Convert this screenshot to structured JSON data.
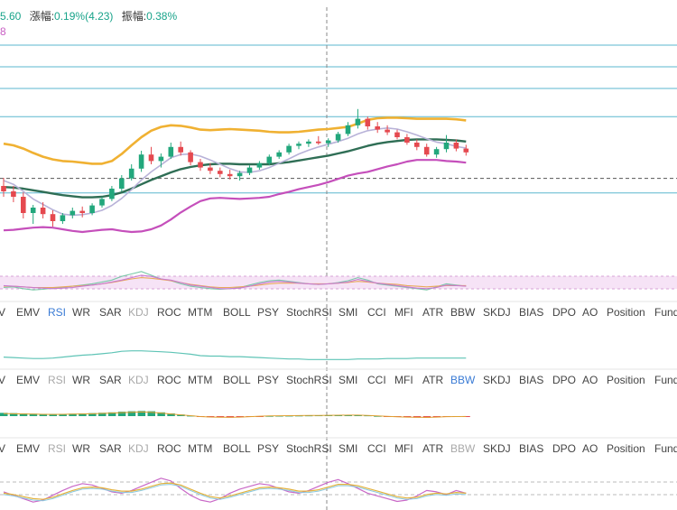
{
  "info": {
    "price_fragment": "5.60",
    "change_label": "漲幅:",
    "change_value": "0.19%(4.23)",
    "amplitude_label": "振幅:",
    "amplitude_value": "0.38%",
    "indicator_fragment": "8"
  },
  "colors": {
    "up": "#22a77c",
    "down": "#e5494f",
    "boll_upper": "#f0b132",
    "boll_mid": "#2f6e55",
    "boll_lower": "#c54fbb",
    "ma": "#b8b2d8",
    "hline": "#5bb7cf",
    "rsi_fill": "#f6e3f6",
    "tab_active": "#3a7bd5"
  },
  "tab_strips": [
    {
      "active": "RSI",
      "dim": [
        "KDJ"
      ]
    },
    {
      "active": "BBW",
      "dim": [
        "RSI",
        "KDJ"
      ]
    },
    {
      "active": "",
      "dim": [
        "RSI",
        "KDJ",
        "BBW"
      ]
    }
  ],
  "tabs": [
    "V",
    "EMV",
    "RSI",
    "WR",
    "SAR",
    "KDJ",
    "ROC",
    "MTM",
    "BOLL",
    "PSY",
    "StochRSI",
    "SMI",
    "CCI",
    "MFI",
    "ATR",
    "BBW",
    "SKDJ",
    "BIAS",
    "DPO",
    "AO",
    "Position",
    "Fund"
  ],
  "chart_data": {
    "type": "candlestick",
    "candles": [
      [
        56,
        57.5,
        54,
        55
      ],
      [
        55,
        56,
        53,
        54
      ],
      [
        54,
        54.8,
        50,
        51
      ],
      [
        51,
        52.5,
        49,
        52
      ],
      [
        52,
        53,
        50,
        50.8
      ],
      [
        50.8,
        51.5,
        48.5,
        49.5
      ],
      [
        49.5,
        51,
        49,
        50.6
      ],
      [
        50.6,
        52,
        50,
        51.4
      ],
      [
        51.4,
        52.2,
        50.2,
        51
      ],
      [
        51,
        52.8,
        50.6,
        52.4
      ],
      [
        52.4,
        54,
        52,
        53.6
      ],
      [
        53.6,
        56,
        53.2,
        55.5
      ],
      [
        55.5,
        58,
        55,
        57.4
      ],
      [
        57.4,
        60,
        57,
        59.2
      ],
      [
        59.2,
        62.5,
        58.6,
        61.8
      ],
      [
        61.8,
        63.2,
        60,
        60.6
      ],
      [
        60.6,
        62,
        59.4,
        61.4
      ],
      [
        61.4,
        64,
        61,
        63.2
      ],
      [
        63.2,
        64.2,
        61.6,
        62.2
      ],
      [
        62.2,
        62.6,
        59.8,
        60.4
      ],
      [
        60.4,
        61,
        58.8,
        59.4
      ],
      [
        59.4,
        60.2,
        58.2,
        58.8
      ],
      [
        58.8,
        59.4,
        57.6,
        58.2
      ],
      [
        58.2,
        59,
        57.2,
        57.8
      ],
      [
        57.8,
        58.8,
        57,
        58.4
      ],
      [
        58.4,
        59.8,
        58,
        59.4
      ],
      [
        59.4,
        60.6,
        59,
        60.2
      ],
      [
        60.2,
        61.8,
        59.8,
        61.4
      ],
      [
        61.4,
        62.6,
        61,
        62.2
      ],
      [
        62.2,
        63.8,
        61.8,
        63.4
      ],
      [
        63.4,
        64.2,
        62.8,
        63.8
      ],
      [
        63.8,
        64.6,
        63.2,
        64.2
      ],
      [
        64.2,
        65.2,
        63.6,
        63.9
      ],
      [
        63.9,
        64.8,
        63.2,
        64.4
      ],
      [
        64.4,
        66,
        64,
        65.6
      ],
      [
        65.6,
        67.8,
        65.2,
        67.2
      ],
      [
        67.2,
        70.2,
        66.6,
        68.4
      ],
      [
        68.4,
        68.8,
        66.4,
        67
      ],
      [
        67,
        67.8,
        65.8,
        66.4
      ],
      [
        66.4,
        67.2,
        65.4,
        65.9
      ],
      [
        65.9,
        66.4,
        64.6,
        65
      ],
      [
        65,
        65.6,
        63.6,
        64
      ],
      [
        64,
        64.6,
        62.6,
        63.2
      ],
      [
        63.2,
        63.8,
        61.4,
        61.8
      ],
      [
        61.8,
        63.2,
        61.2,
        62.8
      ],
      [
        62.8,
        65.4,
        62.2,
        64
      ],
      [
        64,
        64.6,
        62.4,
        62.9
      ],
      [
        62.9,
        63.6,
        61.6,
        62.2
      ]
    ],
    "boll_upper": [
      63.8,
      63.5,
      62.9,
      62.1,
      61.4,
      60.9,
      60.6,
      60.5,
      60.3,
      60.1,
      60.1,
      60.6,
      61.9,
      63.5,
      65,
      66.2,
      66.9,
      67.2,
      67.1,
      66.8,
      66.4,
      66.3,
      66.4,
      66.5,
      66.4,
      66.3,
      66.2,
      66,
      65.9,
      65.9,
      66,
      66.2,
      66.4,
      66.5,
      66.7,
      66.9,
      67.5,
      68.2,
      68.5,
      68.6,
      68.6,
      68.5,
      68.4,
      68.4,
      68.4,
      68.4,
      68.3,
      68.1
    ],
    "boll_mid": [
      55.8,
      55.7,
      55.5,
      55.2,
      54.9,
      54.6,
      54.3,
      54.1,
      53.9,
      53.9,
      54,
      54.3,
      54.8,
      55.5,
      56.3,
      57.1,
      57.8,
      58.5,
      59.1,
      59.5,
      59.8,
      60,
      60.1,
      60.1,
      60,
      60,
      60,
      60,
      60.2,
      60.4,
      60.7,
      61,
      61.3,
      61.6,
      62,
      62.4,
      62.9,
      63.4,
      63.8,
      64.1,
      64.3,
      64.5,
      64.6,
      64.6,
      64.6,
      64.5,
      64.4,
      64.2
    ],
    "boll_lower": [
      47.8,
      47.9,
      48.1,
      48.3,
      48.4,
      48.3,
      48,
      47.7,
      47.5,
      47.7,
      47.9,
      48,
      47.7,
      47.5,
      47.6,
      48,
      48.7,
      49.8,
      51.1,
      52.2,
      53.2,
      53.7,
      53.8,
      53.7,
      53.6,
      53.7,
      53.8,
      54,
      54.5,
      54.9,
      55.4,
      55.8,
      56.2,
      56.7,
      57.3,
      57.9,
      58.3,
      58.6,
      59.1,
      59.6,
      60,
      60.5,
      60.8,
      60.8,
      60.8,
      60.6,
      60.5,
      60.3
    ],
    "ma": [
      57,
      56.3,
      55,
      53.6,
      52.6,
      51.6,
      50.8,
      50.6,
      50.7,
      51,
      51.5,
      52.4,
      53.7,
      55.3,
      57.1,
      58.6,
      59.9,
      61.2,
      61.8,
      61.9,
      61.5,
      60.8,
      60,
      59.2,
      58.6,
      58.5,
      58.8,
      59.4,
      60.2,
      61,
      61.9,
      62.6,
      63.2,
      63.7,
      64.2,
      64.8,
      65.6,
      66.2,
      66.5,
      66.7,
      66.5,
      66,
      65.4,
      64.7,
      64.1,
      63.8,
      63.3,
      63
    ],
    "ylim": [
      42,
      82
    ],
    "hlines": [
      82,
      78,
      74,
      68.8,
      54.7
    ],
    "last_price_line": 57.4,
    "rsi_a": [
      44,
      45,
      42,
      40,
      41,
      43,
      44,
      46,
      48,
      50,
      53,
      56,
      62,
      66,
      70,
      64,
      58,
      55,
      50,
      46,
      44,
      42,
      41,
      42,
      44,
      48,
      52,
      55,
      56,
      54,
      52,
      50,
      49,
      50,
      52,
      55,
      60,
      56,
      50,
      48,
      46,
      44,
      42,
      40,
      45,
      50,
      48,
      46
    ],
    "rsi_b": [
      46,
      46,
      45,
      44,
      44,
      44,
      45,
      46,
      47,
      48,
      50,
      52,
      55,
      58,
      60,
      59,
      57,
      55,
      52,
      49,
      47,
      45,
      44,
      44,
      45,
      46,
      48,
      50,
      51,
      51,
      51,
      50,
      50,
      50,
      51,
      52,
      54,
      53,
      51,
      50,
      49,
      47,
      46,
      45,
      46,
      47,
      47,
      47
    ],
    "rsi_c": [
      47,
      46,
      45,
      44,
      43,
      42,
      43,
      44,
      46,
      48,
      50,
      53,
      56,
      60,
      64,
      62,
      58,
      56,
      52,
      48,
      46,
      44,
      42,
      42,
      43,
      46,
      50,
      53,
      54,
      53,
      51,
      50,
      49,
      50,
      51,
      53,
      57,
      54,
      51,
      49,
      47,
      45,
      43,
      42,
      44,
      48,
      47,
      46
    ],
    "bbw": [
      7.2,
      7.1,
      7.0,
      6.9,
      6.9,
      7.0,
      7.2,
      7.4,
      7.6,
      7.7,
      7.9,
      8.1,
      8.4,
      8.5,
      8.5,
      8.4,
      8.3,
      8.2,
      8.0,
      7.8,
      7.5,
      7.4,
      7.4,
      7.3,
      7.3,
      7.2,
      7.1,
      7.0,
      6.9,
      6.8,
      6.8,
      6.7,
      6.7,
      6.7,
      6.7,
      6.7,
      6.8,
      6.8,
      6.8,
      6.9,
      6.9,
      6.9,
      7.0,
      7.0,
      7.0,
      7.0,
      7.0,
      7.0
    ],
    "macd_hist": [
      0.6,
      0.55,
      0.5,
      0.45,
      0.42,
      0.4,
      0.42,
      0.45,
      0.5,
      0.55,
      0.62,
      0.7,
      0.82,
      0.9,
      0.95,
      0.9,
      0.7,
      0.5,
      0.3,
      0.1,
      -0.1,
      -0.2,
      -0.25,
      -0.28,
      -0.22,
      -0.12,
      -0.02,
      0.05,
      0.08,
      0.1,
      0.12,
      0.14,
      0.16,
      0.18,
      0.2,
      0.22,
      0.22,
      0.15,
      0.05,
      -0.05,
      -0.15,
      -0.22,
      -0.28,
      -0.3,
      -0.22,
      -0.12,
      -0.1,
      -0.08
    ],
    "kdj_k": [
      50,
      45,
      40,
      35,
      38,
      45,
      52,
      58,
      62,
      60,
      55,
      50,
      48,
      52,
      58,
      64,
      70,
      66,
      55,
      45,
      38,
      35,
      40,
      48,
      54,
      58,
      62,
      60,
      55,
      50,
      48,
      52,
      58,
      64,
      68,
      62,
      55,
      48,
      44,
      40,
      36,
      38,
      44,
      52,
      50,
      46,
      52,
      48
    ],
    "kdj_d": [
      48,
      46,
      43,
      40,
      39,
      42,
      47,
      52,
      56,
      57,
      56,
      53,
      51,
      51,
      54,
      58,
      62,
      63,
      60,
      54,
      48,
      43,
      41,
      44,
      48,
      52,
      56,
      57,
      56,
      54,
      51,
      51,
      53,
      57,
      61,
      61,
      59,
      55,
      51,
      47,
      43,
      41,
      42,
      46,
      48,
      47,
      49,
      48
    ]
  }
}
